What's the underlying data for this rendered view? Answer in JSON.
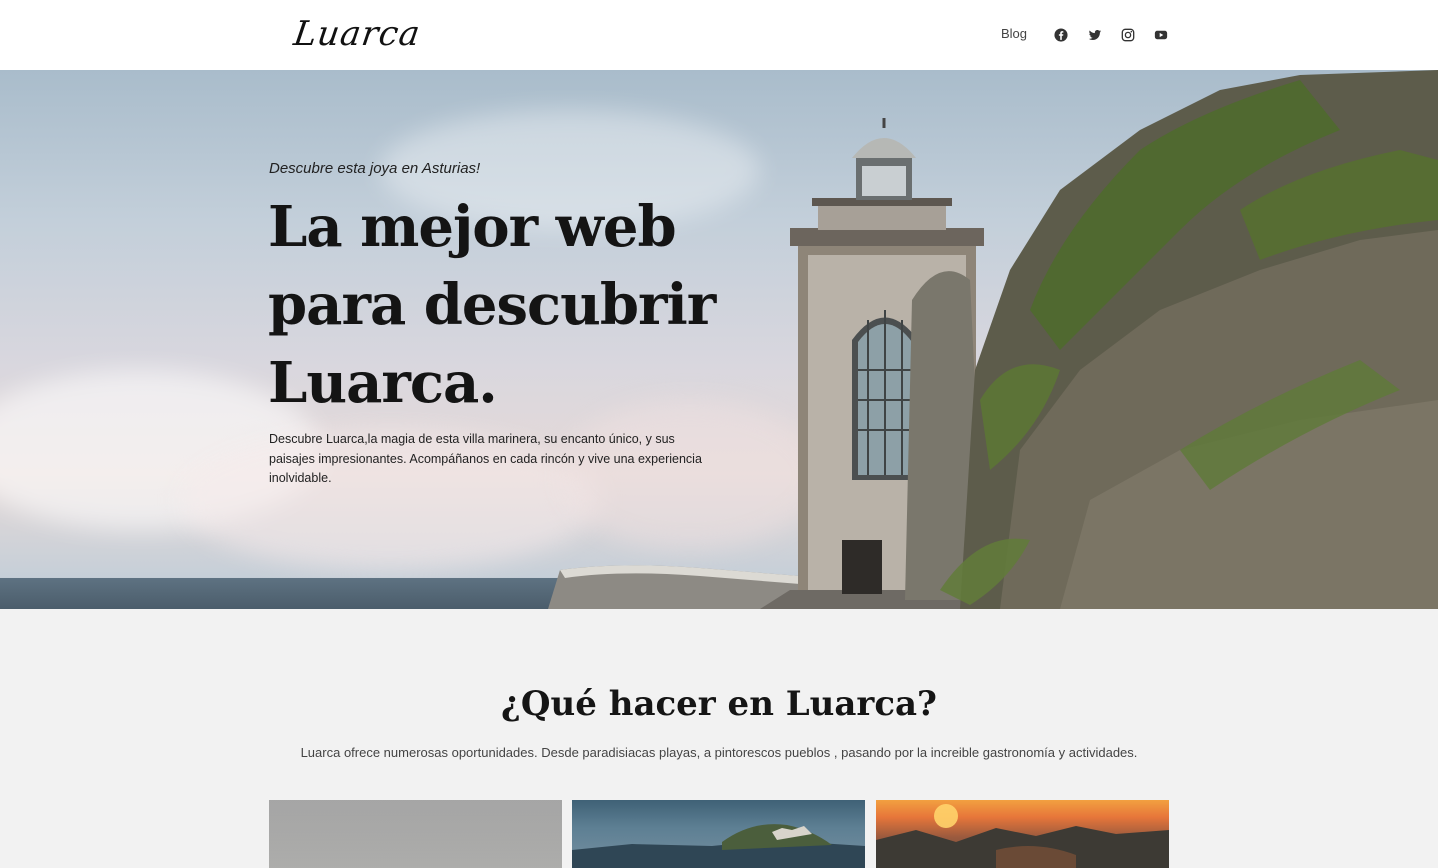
{
  "header": {
    "logo_text": "Luarca",
    "nav_blog": "Blog",
    "social_icons": [
      "facebook-icon",
      "twitter-icon",
      "instagram-icon",
      "youtube-icon"
    ]
  },
  "hero": {
    "kicker": "Descubre esta joya en Asturias!",
    "title": "La mejor web para descubrir Luarca.",
    "description": "Descubre Luarca,la magia de esta villa marinera, su encanto único, y sus paisajes impresionantes. Acompáñanos en cada rincón y vive una experiencia inolvidable."
  },
  "section": {
    "title": "¿Qué hacer en Luarca?",
    "subtitle": "Luarca ofrece numerosas oportunidades. Desde paradisiacas playas, a pintorescos pueblos , pasando por la increible gastronomía y actividades."
  },
  "colors": {
    "header_bg": "#ffffff",
    "page_bg": "#f2f2f2",
    "text_dark": "#141414"
  }
}
